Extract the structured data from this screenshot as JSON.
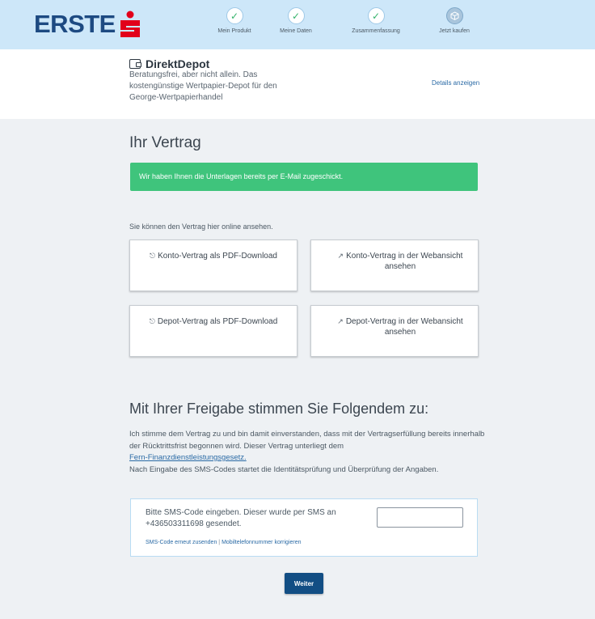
{
  "header": {
    "logo_text": "ERSTE",
    "brand_color": "#1d4a82",
    "accent_color": "#e2001a",
    "steps": [
      {
        "label": "Mein Produkt",
        "status": "done",
        "icon": "check-icon"
      },
      {
        "label": "Meine Daten",
        "status": "done",
        "icon": "check-icon"
      },
      {
        "label": "Zusammenfassung",
        "status": "done",
        "icon": "check-icon"
      },
      {
        "label": "Jetzt kaufen",
        "status": "current",
        "icon": "cube-icon"
      }
    ]
  },
  "product": {
    "title": "DirektDepot",
    "description": "Beratungsfrei, aber nicht allein. Das kostengünstige Wertpapier-Depot für den George-Wertpapierhandel",
    "details_link": "Details anzeigen"
  },
  "contract": {
    "heading": "Ihr Vertrag",
    "alert": "Wir haben Ihnen die Unterlagen bereits per E-Mail zugeschickt.",
    "alert_color": "#3fc47c",
    "intro": "Sie können den Vertrag hier online ansehen.",
    "cards": [
      {
        "label": "Konto-Vertrag als PDF-Download",
        "icon": "download-icon"
      },
      {
        "label": "Konto-Vertrag in der Webansicht ansehen",
        "icon": "external-link-icon"
      },
      {
        "label": "Depot-Vertrag als PDF-Download",
        "icon": "download-icon"
      },
      {
        "label": "Depot-Vertrag in der Webansicht ansehen",
        "icon": "external-link-icon"
      }
    ]
  },
  "consent": {
    "heading": "Mit Ihrer Freigabe stimmen Sie Folgendem zu:",
    "text_before_link": "Ich stimme dem Vertrag zu und bin damit einverstanden, dass mit der Vertragserfüllung bereits innerhalb der Rücktrittsfrist begonnen wird. Dieser Vertrag unterliegt dem",
    "link": "Fern-Finanzdienstleistungsgesetz.",
    "text_after_link": "Nach Eingabe des SMS-Codes startet die Identitätsprüfung und Überprüfung der Angaben."
  },
  "sms": {
    "prompt": "Bitte SMS-Code eingeben. Dieser wurde per SMS an +436503311698 gesendet.",
    "resend_link": "SMS-Code erneut zusenden",
    "separator": "|",
    "correct_link": "Mobiltelefonnummer korrigieren",
    "input_value": ""
  },
  "actions": {
    "next_label": "Weiter",
    "button_color": "#124e84"
  }
}
